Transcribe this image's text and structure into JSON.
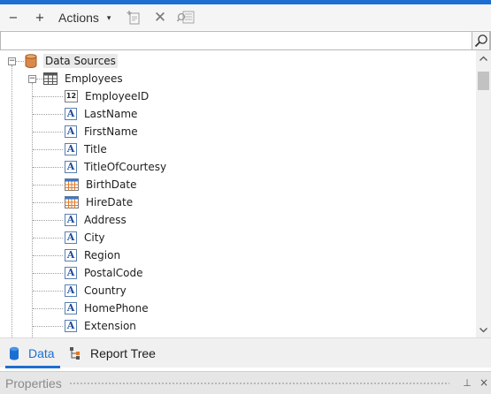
{
  "toolbar": {
    "collapse_label": "−",
    "expand_label": "+",
    "actions_label": "Actions",
    "actions_caret": "▾",
    "remove_glyph": "✕"
  },
  "search": {
    "value": "",
    "placeholder": ""
  },
  "tree": {
    "root": {
      "label": "Data Sources",
      "icon": "database-icon",
      "expanded": true
    },
    "table": {
      "label": "Employees",
      "icon": "table-icon",
      "expanded": true
    },
    "fields": [
      {
        "label": "EmployeeID",
        "type": "number",
        "badge": "12"
      },
      {
        "label": "LastName",
        "type": "string",
        "badge": "A"
      },
      {
        "label": "FirstName",
        "type": "string",
        "badge": "A"
      },
      {
        "label": "Title",
        "type": "string",
        "badge": "A"
      },
      {
        "label": "TitleOfCourtesy",
        "type": "string",
        "badge": "A"
      },
      {
        "label": "BirthDate",
        "type": "date",
        "badge": ""
      },
      {
        "label": "HireDate",
        "type": "date",
        "badge": ""
      },
      {
        "label": "Address",
        "type": "string",
        "badge": "A"
      },
      {
        "label": "City",
        "type": "string",
        "badge": "A"
      },
      {
        "label": "Region",
        "type": "string",
        "badge": "A"
      },
      {
        "label": "PostalCode",
        "type": "string",
        "badge": "A"
      },
      {
        "label": "Country",
        "type": "string",
        "badge": "A"
      },
      {
        "label": "HomePhone",
        "type": "string",
        "badge": "A"
      },
      {
        "label": "Extension",
        "type": "string",
        "badge": "A"
      }
    ]
  },
  "tabs": [
    {
      "label": "Data",
      "active": true,
      "icon": "database-icon"
    },
    {
      "label": "Report Tree",
      "active": false,
      "icon": "report-tree-icon"
    }
  ],
  "properties_panel": {
    "title": "Properties",
    "pin_glyph": "⊥",
    "close_glyph": "×"
  },
  "colors": {
    "accent": "#1c6fd1",
    "database": "#d9894a",
    "string_icon": "#1a4a9a"
  }
}
